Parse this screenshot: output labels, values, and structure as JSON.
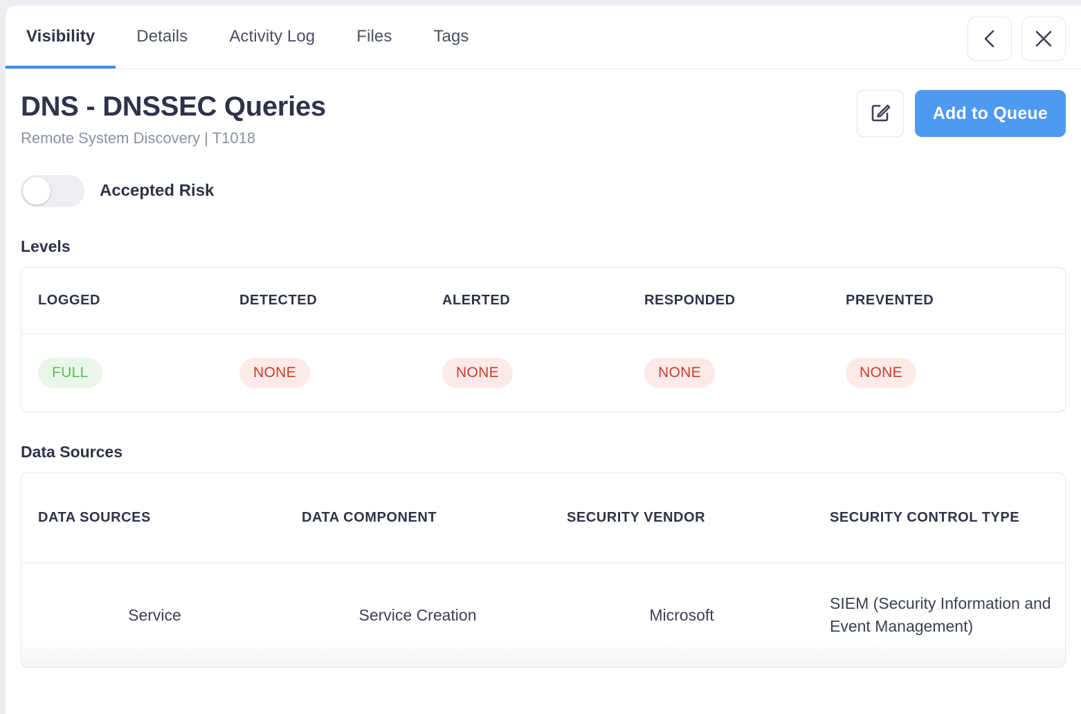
{
  "tabs": [
    {
      "label": "Visibility",
      "active": true
    },
    {
      "label": "Details",
      "active": false
    },
    {
      "label": "Activity Log",
      "active": false
    },
    {
      "label": "Files",
      "active": false
    },
    {
      "label": "Tags",
      "active": false
    }
  ],
  "nav": {
    "back_icon": "chevron-left-icon",
    "close_icon": "close-icon"
  },
  "header": {
    "title": "DNS - DNSSEC Queries",
    "subtitle": "Remote System Discovery | T1018",
    "edit_icon": "edit-pencil-square-icon",
    "primary_button": "Add to Queue"
  },
  "accepted_risk": {
    "label": "Accepted Risk",
    "state": "off"
  },
  "levels": {
    "section_title": "Levels",
    "columns": [
      "LOGGED",
      "DETECTED",
      "ALERTED",
      "RESPONDED",
      "PREVENTED"
    ],
    "values": [
      {
        "text": "FULL",
        "variant": "full"
      },
      {
        "text": "NONE",
        "variant": "none"
      },
      {
        "text": "NONE",
        "variant": "none"
      },
      {
        "text": "NONE",
        "variant": "none"
      },
      {
        "text": "NONE",
        "variant": "none"
      }
    ]
  },
  "data_sources": {
    "section_title": "Data Sources",
    "columns": [
      "DATA SOURCES",
      "DATA COMPONENT",
      "SECURITY VENDOR",
      "SECURITY CONTROL TYPE"
    ],
    "rows": [
      {
        "data_source": "Service",
        "data_component": "Service Creation",
        "security_vendor": "Microsoft",
        "security_control_type": "SIEM (Security Information and Event Management)"
      }
    ]
  },
  "colors": {
    "accent_blue": "#4e9af1",
    "tab_underline": "#3d8ef0",
    "pill_full_text": "#5cb85c",
    "pill_full_bg": "#eaf7e8",
    "pill_none_text": "#cc3b2e",
    "pill_none_bg": "#fbeae7",
    "text_primary": "#2f3349",
    "text_muted": "#8a90a2"
  }
}
